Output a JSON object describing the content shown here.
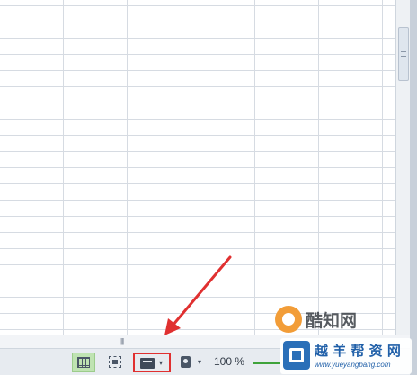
{
  "statusbar": {
    "view_buttons": [
      {
        "name": "normal-view",
        "icon": "grid-view-icon",
        "active": true
      },
      {
        "name": "page-break-view",
        "icon": "page-break-icon",
        "active": false
      },
      {
        "name": "reading-layout-view",
        "icon": "reading-layout-icon",
        "active": false,
        "highlighted": true
      },
      {
        "name": "eye-protection",
        "icon": "eye-protection-icon",
        "active": false
      }
    ],
    "dropdown_glyph": "▾",
    "zoom_minus": "–",
    "zoom_level": "100 %"
  },
  "hscroll": {
    "grip_glyph": "|||"
  },
  "watermark": {
    "top_name": "酷知网",
    "brand": "越 羊 帮 资 网",
    "url": "www.yueyangbang.com"
  },
  "colors": {
    "active_view": "#bfe3b2",
    "highlight_box": "#e03030",
    "arrow": "#e03030",
    "zoom_track": "#3fa33b",
    "grid_line": "#d6dbe2"
  }
}
